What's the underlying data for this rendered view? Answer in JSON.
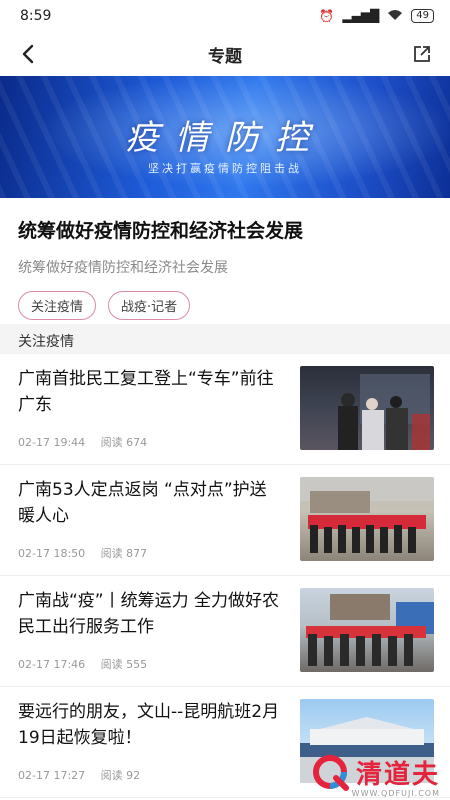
{
  "status_bar": {
    "time": "8:59",
    "signal": "▂▄▆█",
    "battery": "49"
  },
  "nav": {
    "title": "专题"
  },
  "banner": {
    "title": "疫情防控",
    "subtitle": "坚决打赢疫情防控阻击战"
  },
  "topic": {
    "title": "统筹做好疫情防控和经济社会发展",
    "description": "统筹做好疫情防控和经济社会发展",
    "tags": [
      "关注疫情",
      "战疫·记者"
    ]
  },
  "section": {
    "label": "关注疫情"
  },
  "news": [
    {
      "title": "广南首批民工复工登上“专车”前往广东",
      "date": "02-17 19:44",
      "reads": "阅读 674"
    },
    {
      "title": "广南53人定点返岗 “点对点”护送暖人心",
      "date": "02-17 18:50",
      "reads": "阅读 877"
    },
    {
      "title": "广南战“疫”丨统筹运力 全力做好农民工出行服务工作",
      "date": "02-17 17:46",
      "reads": "阅读 555"
    },
    {
      "title": "要远行的朋友，文山--昆明航班2月19日起恢复啦！",
      "date": "02-17 17:27",
      "reads": "阅读 92"
    }
  ],
  "watermark": {
    "text": "清道夫",
    "url": "WWW.QDFUJI.COM"
  },
  "colors": {
    "tag_border": "#d98ca8",
    "watermark": "#e5233d",
    "banner": "#1e5bd8"
  }
}
